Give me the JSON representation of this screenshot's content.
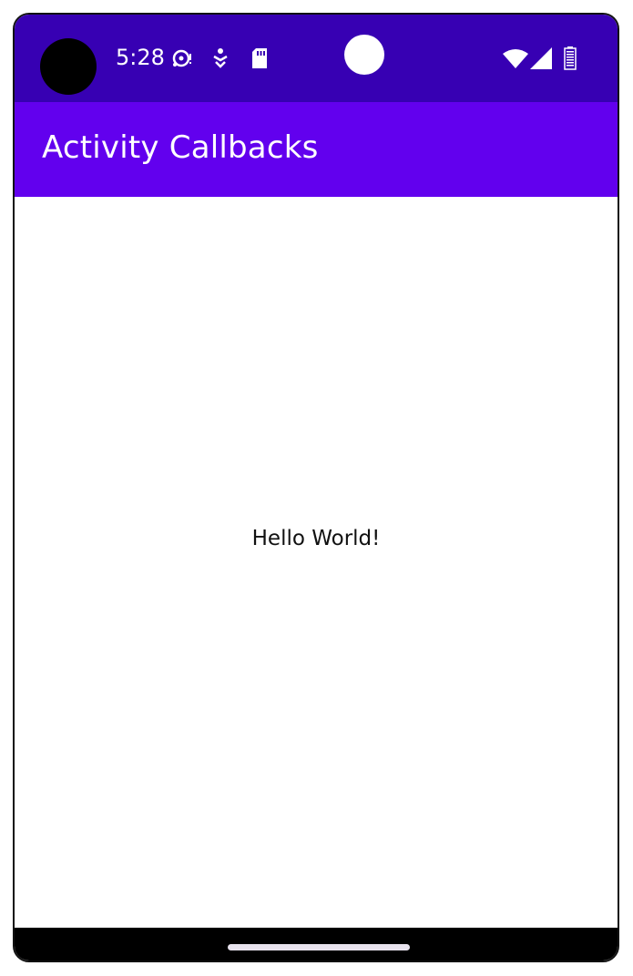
{
  "status_bar": {
    "time": "5:28",
    "background_color": "#3700b3",
    "icons": [
      "camera-cutout",
      "media-sync-icon",
      "accessibility-icon",
      "sd-card-icon",
      "front-sensor",
      "wifi-icon",
      "cellular-signal-icon",
      "battery-icon"
    ]
  },
  "app_bar": {
    "title": "Activity Callbacks",
    "background_color": "#6200ee"
  },
  "main": {
    "message": "Hello World!"
  },
  "navigation": {
    "handle": "home-gesture-handle"
  }
}
